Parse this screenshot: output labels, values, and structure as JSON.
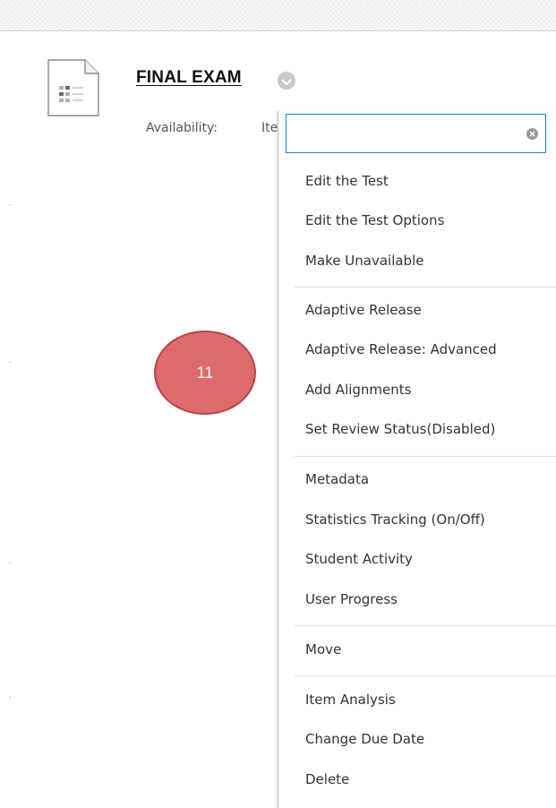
{
  "item": {
    "title": "FINAL EXAM",
    "availability_label": "Availability:",
    "availability_value": "Item is available"
  },
  "step_badge": "11",
  "menu": {
    "search_value": "",
    "items": [
      "Edit the Test",
      "Edit the Test Options",
      "Make Unavailable",
      "Adaptive Release",
      "Adaptive Release: Advanced",
      "Add Alignments",
      "Set Review Status(Disabled)",
      "Metadata",
      "Statistics Tracking (On/Off)",
      "Student Activity",
      "User Progress",
      "Move",
      "Item Analysis",
      "Change Due Date",
      "Delete"
    ]
  },
  "colors": {
    "search_border": "#1a7fd6",
    "badge_fill": "#df6a6e",
    "badge_border": "#b7454a"
  },
  "icons": {
    "item": "test-document-icon",
    "options": "chevron-down-icon",
    "clear": "clear-icon"
  }
}
